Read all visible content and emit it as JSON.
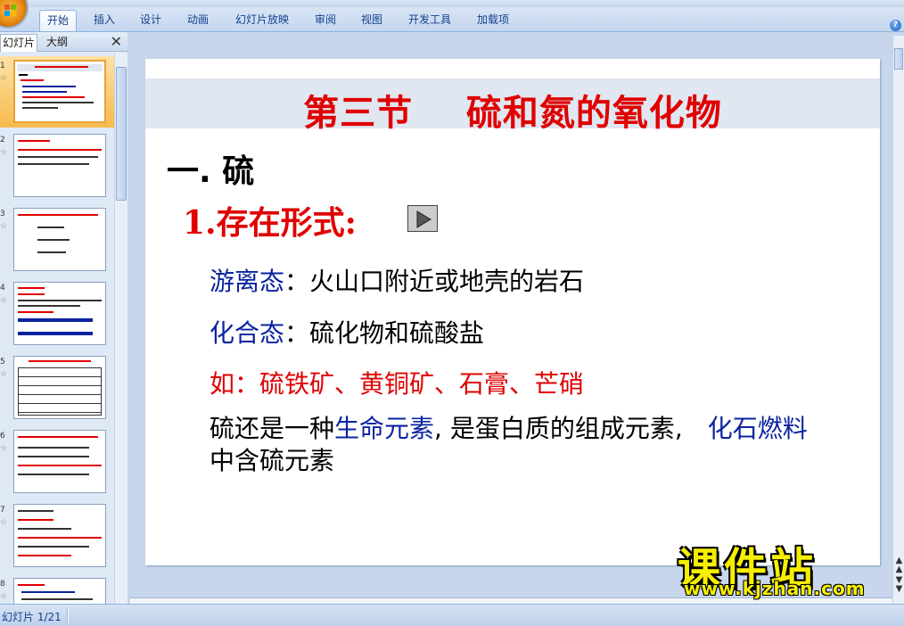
{
  "ribbon": {
    "tabs": [
      "开始",
      "插入",
      "设计",
      "动画",
      "幻灯片放映",
      "审阅",
      "视图",
      "开发工具",
      "加载项"
    ],
    "active_tab": "开始"
  },
  "left_panel": {
    "tab_slides": "幻灯片",
    "tab_outline": "大纲",
    "close_symbol": "✕",
    "thumbnails": [
      {
        "num": "1",
        "star": "☆"
      },
      {
        "num": "2",
        "star": "☆"
      },
      {
        "num": "3",
        "star": "☆"
      },
      {
        "num": "4",
        "star": "☆"
      },
      {
        "num": "5",
        "star": "☆"
      },
      {
        "num": "6",
        "star": "☆"
      },
      {
        "num": "7",
        "star": "☆"
      },
      {
        "num": "8",
        "star": "☆"
      }
    ]
  },
  "slide": {
    "title": "第三节    硫和氮的氧化物",
    "section": "一. 硫",
    "point1": "1.存在形式:",
    "free_state_label": "游离态",
    "free_state_sep": "：",
    "free_state_text": "火山口附近或地壳的岩石",
    "compound_state_label": "化合态",
    "compound_state_sep": "：",
    "compound_state_text": "硫化物和硫酸盐",
    "example_text": "如：硫铁矿、黄铜矿、石膏、芒硝",
    "life_pre": "硫还是一种",
    "life_hl1": "生命元素",
    "life_mid": ", 是蛋白质的组成元素,　",
    "life_hl2": "化石燃料",
    "life_post": "中含硫元素"
  },
  "status_bar": {
    "slide_counter": "幻灯片 1/21"
  },
  "watermark": {
    "brand": "课件站",
    "url": "www.kjzhan.com"
  },
  "colors": {
    "title_red": "#e00000",
    "term_blue": "#0a23a0",
    "ribbon_bg": "#c4d6ef",
    "selected_thumb": "#f7b94d"
  }
}
